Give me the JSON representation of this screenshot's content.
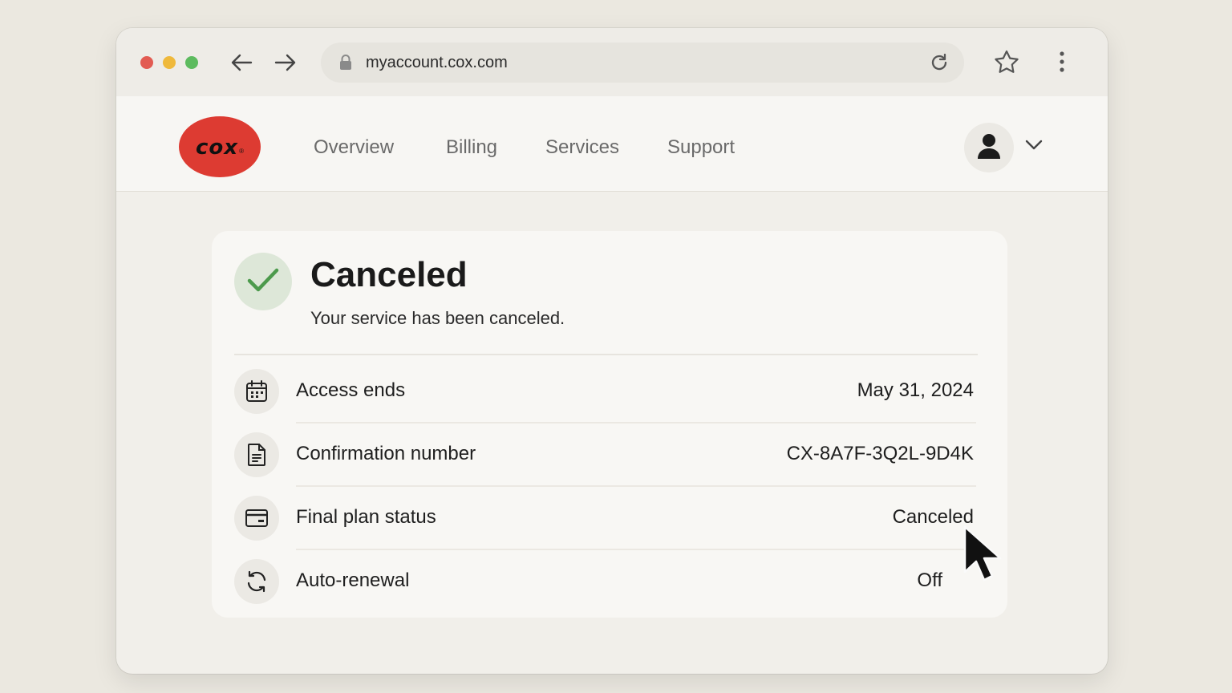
{
  "browser": {
    "url": "myaccount.cox.com",
    "icons": [
      "back-arrow-icon",
      "forward-arrow-icon",
      "lock-icon",
      "reload-icon",
      "star-icon",
      "kebab-menu-icon"
    ]
  },
  "header": {
    "logo_text": "cox",
    "logo_reg": "®",
    "nav": [
      "Overview",
      "Billing",
      "Services",
      "Support"
    ],
    "brand_color": "#dd3b32"
  },
  "status": {
    "title": "Canceled",
    "message": "Your service has been canceled.",
    "accent_color": "#4c9a4c"
  },
  "details": [
    {
      "icon": "calendar-icon",
      "label": "Access ends",
      "value": "May 31, 2024"
    },
    {
      "icon": "document-icon",
      "label": "Confirmation number",
      "value": "CX-8A7F-3Q2L-9D4K"
    },
    {
      "icon": "credit-card-icon",
      "label": "Final plan status",
      "value": "Canceled"
    },
    {
      "icon": "refresh-icon",
      "label": "Auto-renewal",
      "value": "Off"
    }
  ]
}
